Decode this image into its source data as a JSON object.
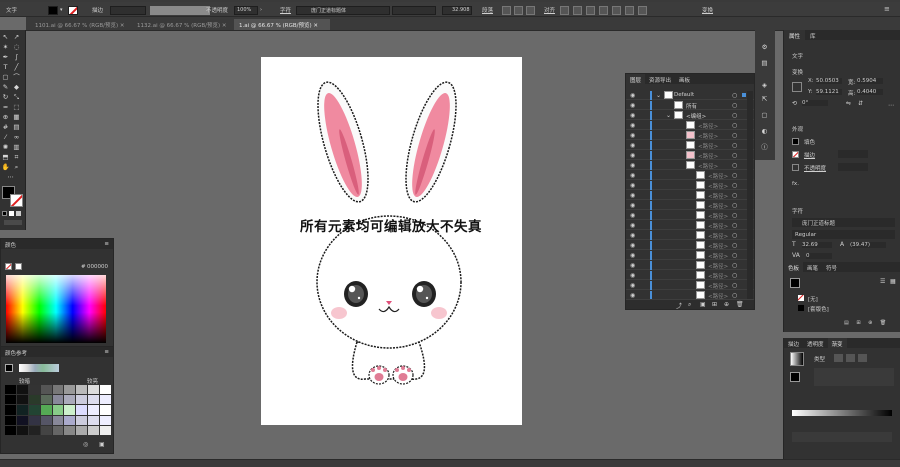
{
  "control_bar": {
    "selection_type": "文字",
    "stroke_label": "描边",
    "opacity_label": "不透明度",
    "opacity_value": "100%",
    "character_label": "字符",
    "font_name": "庞门正道标题体",
    "font_size": "32.908",
    "paragraph_label": "段落",
    "align_label": "对齐",
    "transform_label": "变换"
  },
  "document_tabs": [
    {
      "label": "1101.ai @ 66.67 % (RGB/预览)",
      "active": false
    },
    {
      "label": "1132.ai @ 66.67 % (RGB/预览)",
      "active": false
    },
    {
      "label": "1.ai @ 66.67 % (RGB/预览)",
      "active": true
    }
  ],
  "artboard": {
    "overlay_text": "所有元素均可编辑放大不失真"
  },
  "color_panel": {
    "title": "颜色",
    "hex_value": "000000"
  },
  "swatch_panel": {
    "title": "颜色参考",
    "col_left": "较暗",
    "col_right": "较亮"
  },
  "layers_panel": {
    "tabs": [
      "图层",
      "资源导出",
      "画板"
    ],
    "rows": [
      {
        "name": "Default",
        "depth": 0
      },
      {
        "name": "所有",
        "depth": 1
      },
      {
        "name": "<编组>",
        "depth": 1
      },
      {
        "name": "<路径>",
        "depth": 2
      },
      {
        "name": "<路径>",
        "depth": 2
      },
      {
        "name": "<路径>",
        "depth": 2
      },
      {
        "name": "<路径>",
        "depth": 2
      },
      {
        "name": "<路径>",
        "depth": 2
      },
      {
        "name": "<路径>",
        "depth": 2
      },
      {
        "name": "<路径>",
        "depth": 2
      },
      {
        "name": "<路径>",
        "depth": 2
      },
      {
        "name": "<路径>",
        "depth": 2
      },
      {
        "name": "<路径>",
        "depth": 2
      },
      {
        "name": "<路径>",
        "depth": 2
      },
      {
        "name": "<路径>",
        "depth": 2
      },
      {
        "name": "<路径>",
        "depth": 2
      },
      {
        "name": "<路径>",
        "depth": 2
      },
      {
        "name": "<路径>",
        "depth": 2
      },
      {
        "name": "<路径>",
        "depth": 2
      },
      {
        "name": "<路径>",
        "depth": 2
      },
      {
        "name": "<路径>",
        "depth": 2
      }
    ]
  },
  "properties_panel": {
    "tabs": [
      "属性",
      "库"
    ],
    "section_title": "文字",
    "transform_title": "变换",
    "x_label": "X:",
    "x_value": "50.0503",
    "y_label": "Y:",
    "y_value": "59.1121",
    "w_label": "宽:",
    "w_value": "0.5904",
    "h_label": "高:",
    "h_value": "0.4040",
    "angle_value": "0°",
    "appearance_title": "外观",
    "fill_label": "填色",
    "stroke_label": "描边",
    "opacity_label": "不透明度",
    "fx_label": "fx.",
    "character_title": "字符",
    "font_name": "庞门正道标题",
    "font_style": "Regular",
    "font_size": "32.69",
    "leading": "(39.47)",
    "tracking": "0"
  },
  "appearance_panel": {
    "tabs": [
      "色板",
      "画笔",
      "符号"
    ],
    "rows": [
      "[无]",
      "[套版色]"
    ]
  },
  "gradient_panel": {
    "tabs": [
      "描边",
      "透明度",
      "渐变"
    ],
    "type_label": "类型"
  },
  "colors": {
    "ui_dark": "#323232",
    "canvas": "#6a6a6a",
    "ear_pink": "#f08aa0",
    "selection_blue": "#4a90d9"
  }
}
